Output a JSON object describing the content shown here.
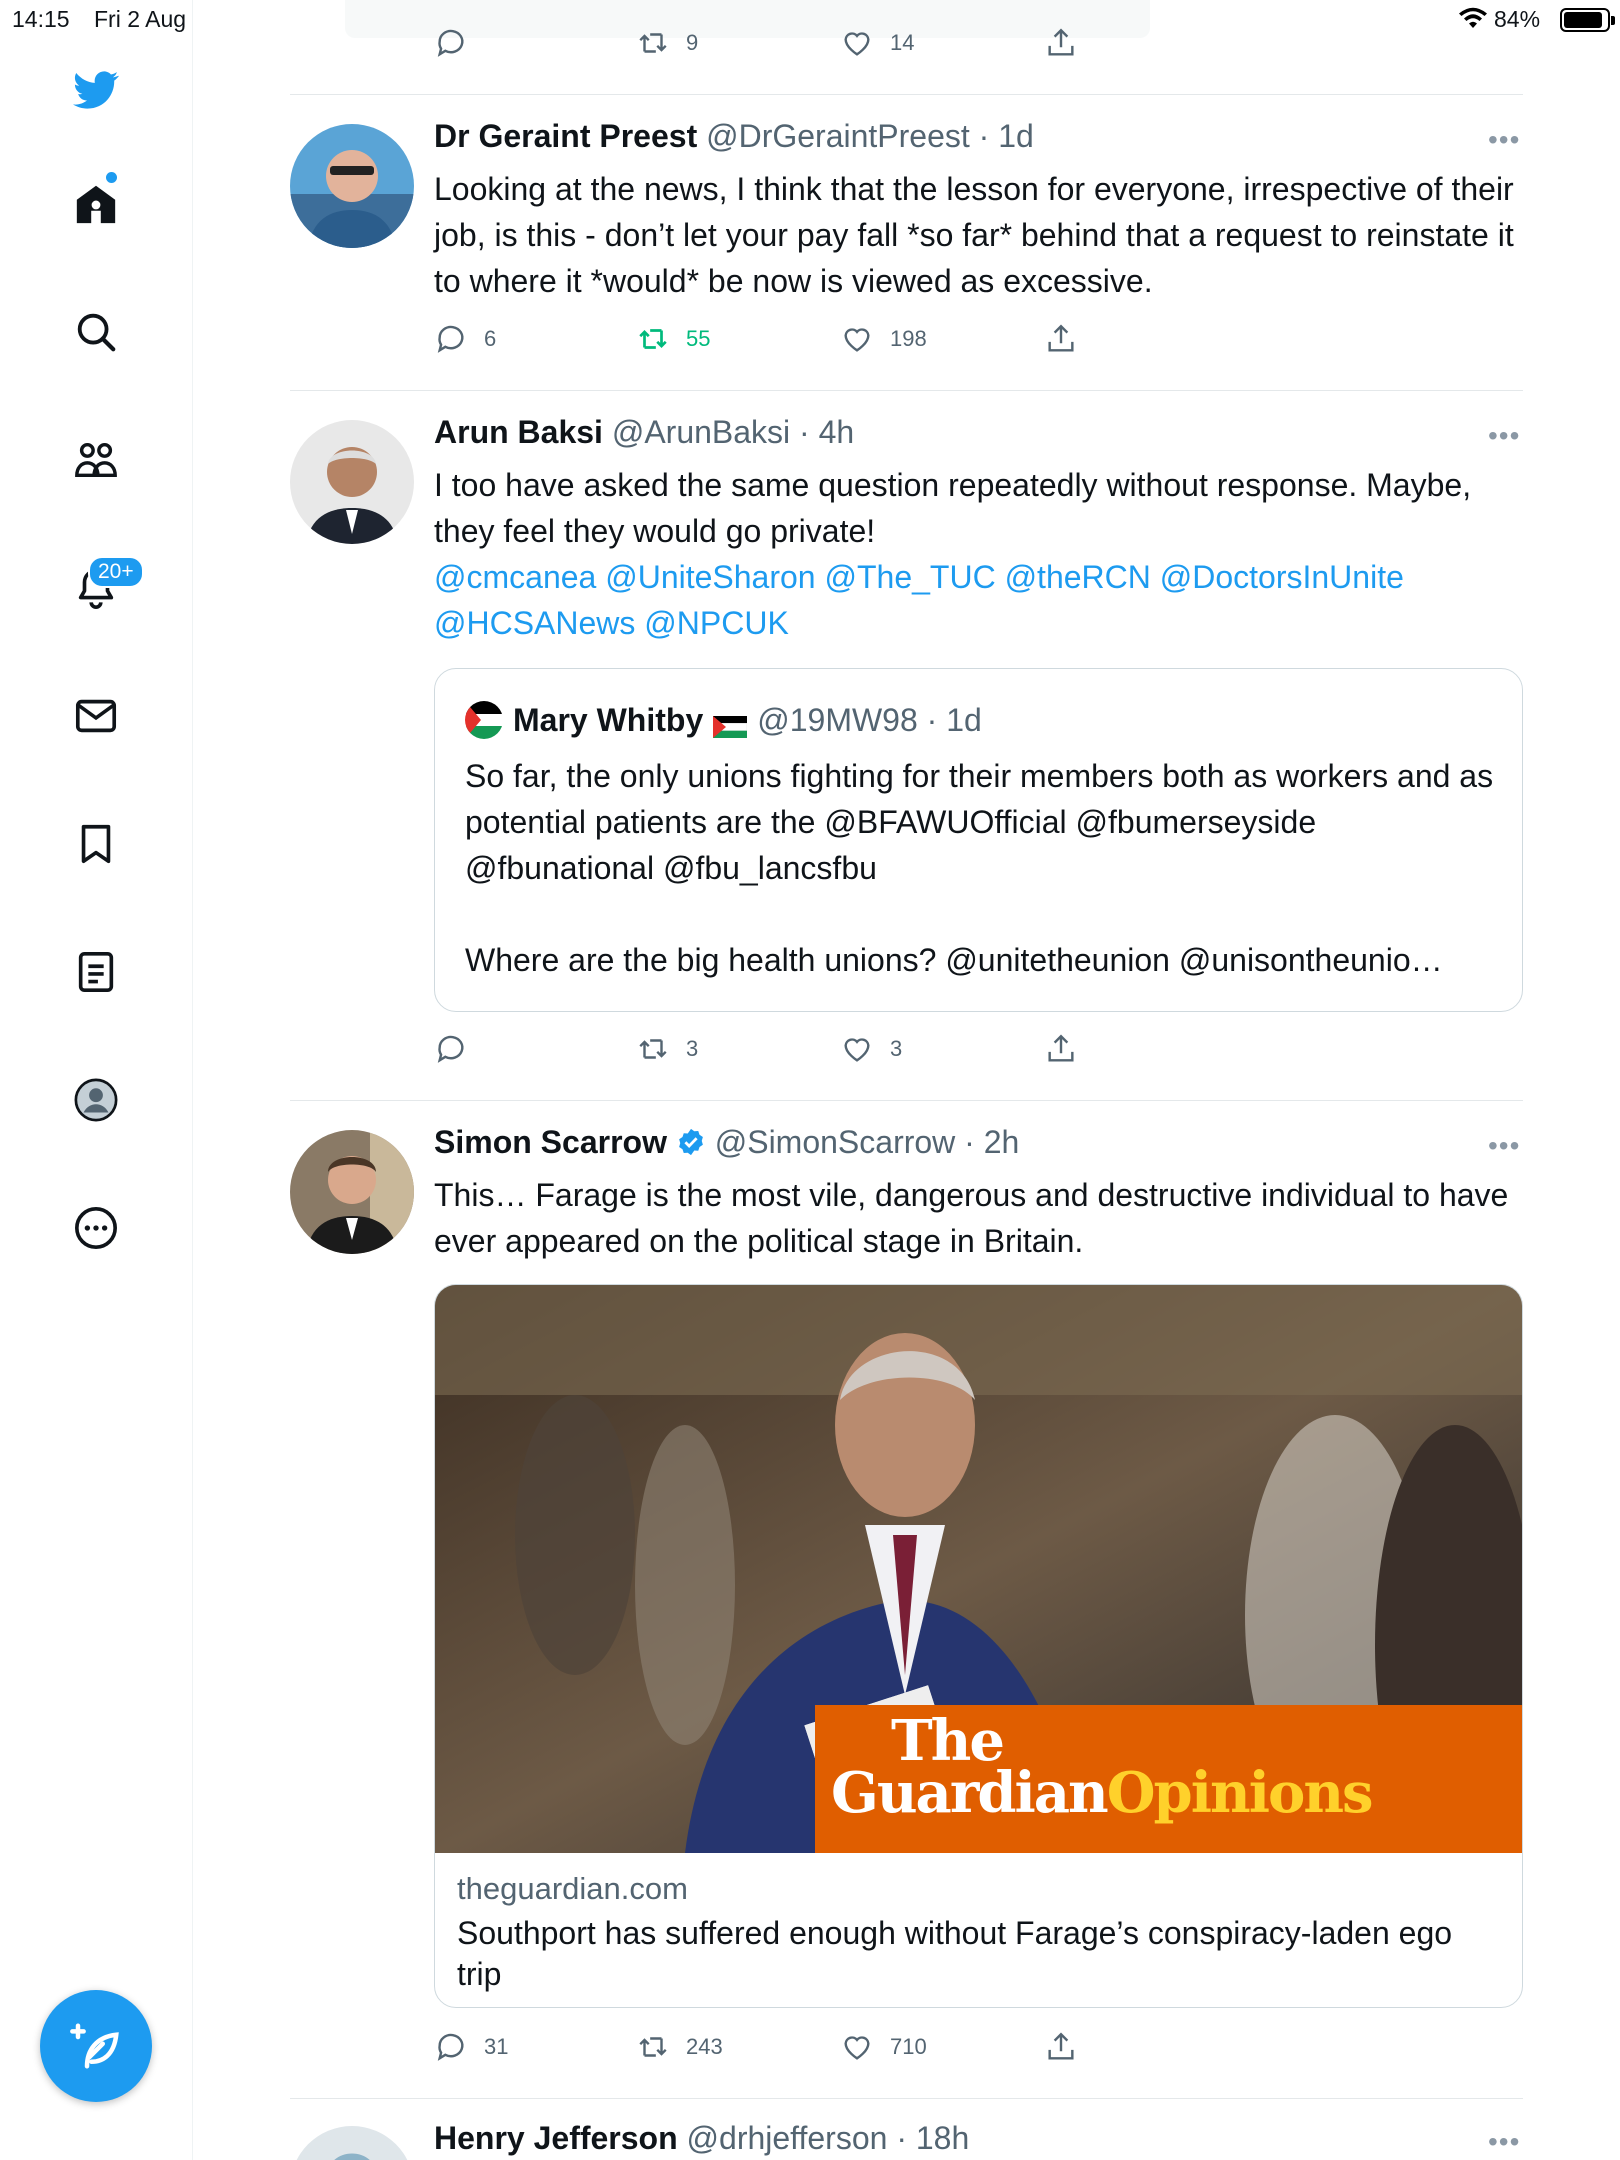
{
  "status_bar": {
    "time": "14:15",
    "date": "Fri 2 Aug",
    "battery": "84%"
  },
  "sidebar": {
    "notifications_badge": "20+"
  },
  "top_partial": {
    "retweets": "9",
    "likes": "14"
  },
  "tweets": [
    {
      "name": "Dr Geraint Preest",
      "handle": "@DrGeraintPreest · 1d",
      "text": "Looking at the news, I think that the lesson for everyone, irrespective of their job, is this - don’t let your pay fall *so far* behind that a request to reinstate it to where it *would* be now is viewed as excessive.",
      "replies": "6",
      "retweets": "55",
      "likes": "198"
    },
    {
      "name": "Arun Baksi",
      "handle": "@ArunBaksi · 4h",
      "text": "I too have asked the same question repeatedly without response. Maybe, they feel they would go private!",
      "mentions": "@cmcanea @UniteSharon @The_TUC @theRCN @DoctorsInUnite @HCSANews @NPCUK",
      "quote": {
        "name": "Mary Whitby",
        "handle": "@19MW98 · 1d",
        "text1": "So far, the only unions fighting for their members both as workers and as potential patients are the @BFAWUOfficial  @fbumerseyside @fbunational @fbu_lancsfbu",
        "text2": "Where are the big health unions? @unitetheunion @unisontheunio…"
      },
      "replies": "",
      "retweets": "3",
      "likes": "3"
    },
    {
      "name": "Simon Scarrow",
      "handle": "@SimonScarrow · 2h",
      "text": "This… Farage is the most vile, dangerous and destructive individual to have ever appeared on the political stage in Britain.",
      "card": {
        "brand_line1": "The",
        "brand_line2": "Guardian",
        "brand_opinions": "Opinions",
        "domain": "theguardian.com",
        "headline": "Southport has suffered enough without Farage’s conspiracy-laden ego trip"
      },
      "replies": "31",
      "retweets": "243",
      "likes": "710"
    },
    {
      "name": "Henry Jefferson",
      "handle": "@drhjefferson · 18h"
    }
  ]
}
